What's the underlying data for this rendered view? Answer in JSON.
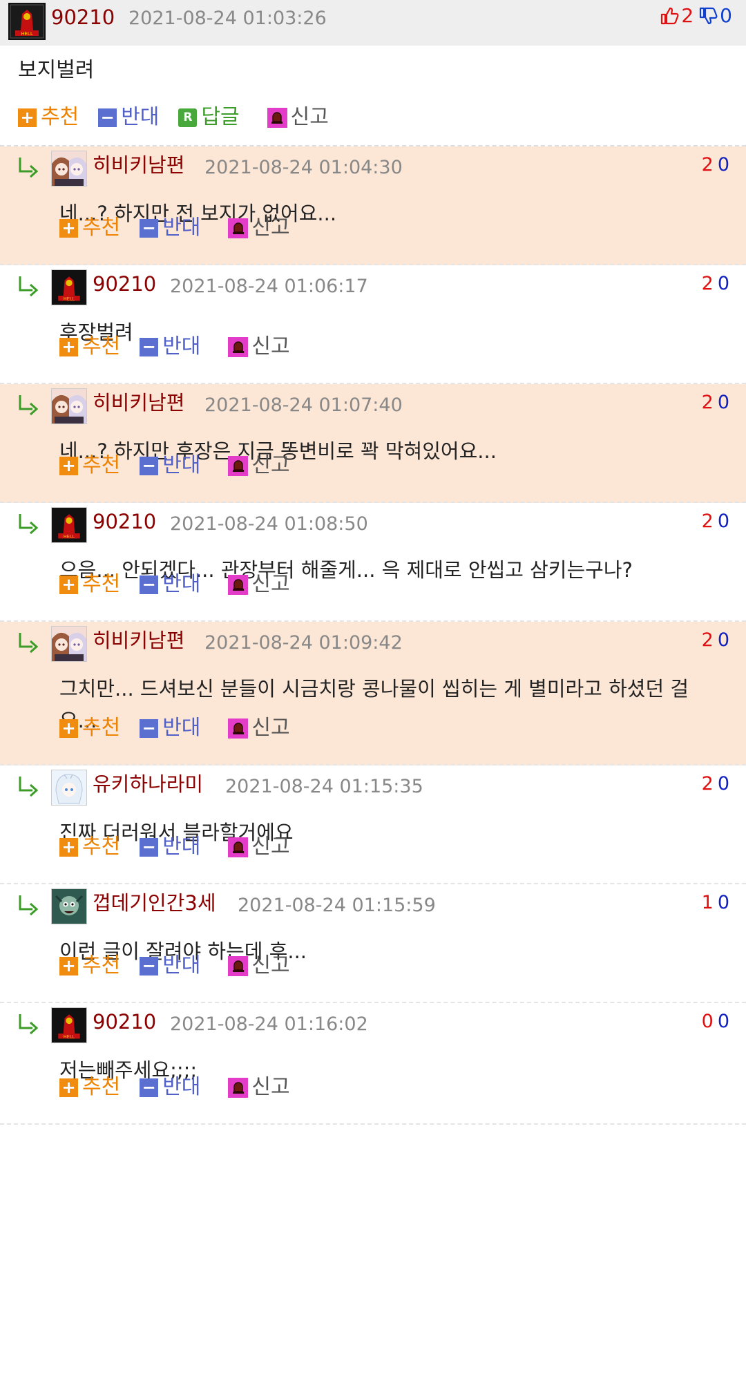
{
  "root": {
    "nick": "90210",
    "date": "2021-08-24 01:03:26",
    "up": "2",
    "down": "0",
    "text": "보지벌려",
    "actions": {
      "recommend": "추천",
      "oppose": "반대",
      "reply": "답글",
      "report": "신고"
    }
  },
  "colors": {
    "nick": "#8b0000",
    "alt_bg": "#fce6d6",
    "recommend": "#ee8300",
    "oppose": "#5060c8",
    "reply": "#3c9c28",
    "report_icon": "#e33cc8"
  },
  "replies": [
    {
      "nick": "히비키남편",
      "date": "2021-08-24 01:04:30",
      "up": "2",
      "down": "0",
      "text": "네...? 하지만 전 보지가 없어요...",
      "recommend": "추천",
      "oppose": "반대",
      "report": "신고",
      "avatar": "anime-girls-avatar"
    },
    {
      "nick": "90210",
      "date": "2021-08-24 01:06:17",
      "up": "2",
      "down": "0",
      "text": "후장벌려",
      "recommend": "추천",
      "oppose": "반대",
      "report": "신고",
      "avatar": "devil-avatar"
    },
    {
      "nick": "히비키남편",
      "date": "2021-08-24 01:07:40",
      "up": "2",
      "down": "0",
      "text": "네...? 하지만 후장은 지금 똥변비로 꽉 막혀있어요...",
      "recommend": "추천",
      "oppose": "반대",
      "report": "신고",
      "avatar": "anime-girls-avatar"
    },
    {
      "nick": "90210",
      "date": "2021-08-24 01:08:50",
      "up": "2",
      "down": "0",
      "text": "으음... 안되겠다... 관장부터 해줄게... 윽 제대로 안씹고 삼키는구나?",
      "recommend": "추천",
      "oppose": "반대",
      "report": "신고",
      "avatar": "devil-avatar"
    },
    {
      "nick": "히비키남편",
      "date": "2021-08-24 01:09:42",
      "up": "2",
      "down": "0",
      "text": "그치만... 드셔보신 분들이 시금치랑 콩나물이 씹히는 게 별미라고 하셨던 걸요...",
      "recommend": "추천",
      "oppose": "반대",
      "report": "신고",
      "avatar": "anime-girls-avatar"
    },
    {
      "nick": "유키하나라미",
      "date": "2021-08-24 01:15:35",
      "up": "2",
      "down": "0",
      "text": "진짜 더러워서 블라할거에요",
      "recommend": "추천",
      "oppose": "반대",
      "report": "신고",
      "avatar": "anime-whitehair-avatar"
    },
    {
      "nick": "껍데기인간3세",
      "date": "2021-08-24 01:15:59",
      "up": "1",
      "down": "0",
      "text": "이런 글이 잘려야 하는데 후...",
      "recommend": "추천",
      "oppose": "반대",
      "report": "신고",
      "avatar": "dark-character-avatar"
    },
    {
      "nick": "90210",
      "date": "2021-08-24 01:16:02",
      "up": "0",
      "down": "0",
      "text": "저는빼주세요;;;;",
      "recommend": "추천",
      "oppose": "반대",
      "report": "신고",
      "avatar": "devil-avatar"
    }
  ]
}
